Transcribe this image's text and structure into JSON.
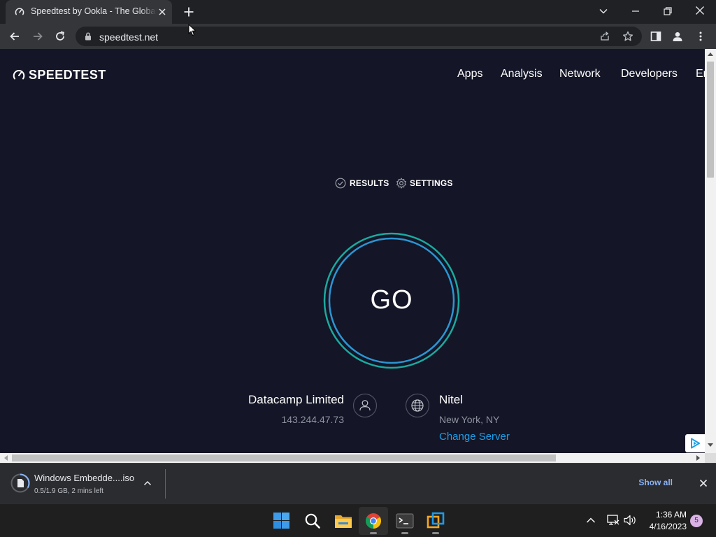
{
  "browser": {
    "tab_title": "Speedtest by Ookla - The Global Broadband Speed Test",
    "url": "speedtest.net"
  },
  "site": {
    "logo_text": "SPEEDTEST",
    "nav": [
      "Apps",
      "Analysis",
      "Network",
      "Developers",
      "Enterprise"
    ],
    "results_label": "RESULTS",
    "settings_label": "SETTINGS",
    "go_label": "GO",
    "isp_name": "Datacamp Limited",
    "ip_address": "143.244.47.73",
    "server_name": "Nitel",
    "server_location": "New York, NY",
    "change_server_label": "Change Server"
  },
  "downloads": {
    "file_name": "Windows Embedde....iso",
    "progress_text": "0.5/1.9 GB, 2 mins left",
    "show_all_label": "Show all"
  },
  "taskbar": {
    "time": "1:36 AM",
    "date": "4/16/2023",
    "notification_count": "5"
  },
  "colors": {
    "page_bg": "#141526",
    "go_ring": "#1bc4b6",
    "go_ring_inner": "#2fa3e6",
    "link": "#1e9fe8"
  }
}
